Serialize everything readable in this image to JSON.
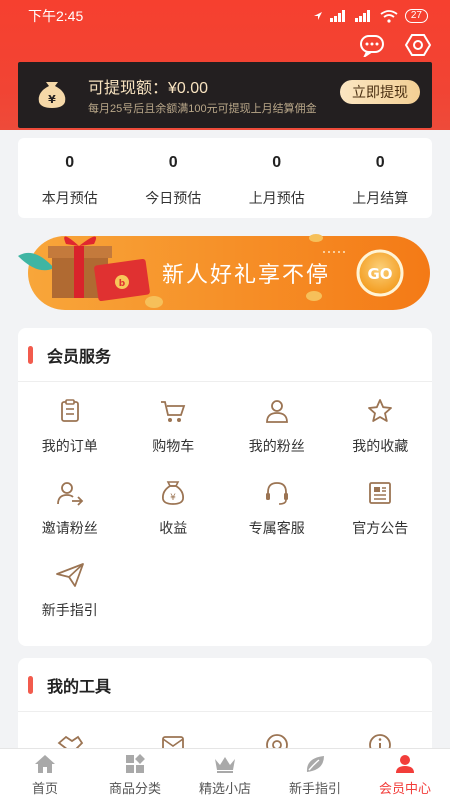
{
  "status_bar": {
    "time": "下午2:45",
    "battery": "27"
  },
  "withdraw": {
    "title": "可提现额：¥0.00",
    "subtitle": "每月25号后且余额满100元可提现上月结算佣金",
    "button": "立即提现"
  },
  "stats": [
    {
      "value": "0",
      "label": "本月预估"
    },
    {
      "value": "0",
      "label": "今日预估"
    },
    {
      "value": "0",
      "label": "上月预估"
    },
    {
      "value": "0",
      "label": "上月结算"
    }
  ],
  "banner": {
    "text": "新人好礼享不停",
    "go": "GO"
  },
  "member_services": {
    "title": "会员服务",
    "items": [
      {
        "label": "我的订单",
        "icon": "clipboard-icon"
      },
      {
        "label": "购物车",
        "icon": "cart-icon"
      },
      {
        "label": "我的粉丝",
        "icon": "person-icon"
      },
      {
        "label": "我的收藏",
        "icon": "star-icon"
      },
      {
        "label": "邀请粉丝",
        "icon": "invite-user-icon"
      },
      {
        "label": "收益",
        "icon": "money-bag-icon"
      },
      {
        "label": "专属客服",
        "icon": "headset-icon"
      },
      {
        "label": "官方公告",
        "icon": "newspaper-icon"
      },
      {
        "label": "新手指引",
        "icon": "paper-plane-icon"
      }
    ]
  },
  "my_tools": {
    "title": "我的工具"
  },
  "tabs": [
    {
      "label": "首页",
      "icon": "home-icon"
    },
    {
      "label": "商品分类",
      "icon": "category-icon"
    },
    {
      "label": "精选小店",
      "icon": "crown-icon"
    },
    {
      "label": "新手指引",
      "icon": "leaf-icon"
    },
    {
      "label": "会员中心",
      "icon": "member-icon",
      "active": true
    }
  ],
  "colors": {
    "brand_red": "#f23d3a",
    "gold": "#f5d8a8",
    "icon_brown": "#9b7453"
  }
}
